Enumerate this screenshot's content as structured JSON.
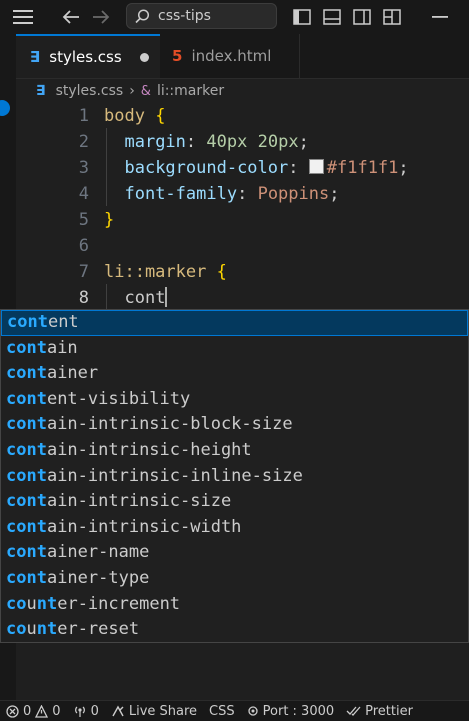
{
  "titlebar": {
    "search_text": "css-tips"
  },
  "tabs": [
    {
      "label": "styles.css",
      "icon": "css-file-icon",
      "active": true,
      "dirty": true
    },
    {
      "label": "index.html",
      "icon": "html-file-icon",
      "active": false
    }
  ],
  "breadcrumbs": {
    "file": "styles.css",
    "separator": "›",
    "symbol": "li::marker"
  },
  "editor": {
    "line_numbers": [
      "1",
      "2",
      "3",
      "4",
      "5",
      "6",
      "7",
      "8"
    ],
    "l1_selector": "body",
    "l1_brace": "{",
    "l2_prop": "margin",
    "l2_colon": ":",
    "l2_val1": "40px",
    "l2_val2": "20px",
    "l2_semi": ";",
    "l3_prop": "background-color",
    "l3_colon": ":",
    "l3_val": "#f1f1f1",
    "l3_semi": ";",
    "l4_prop": "font-family",
    "l4_colon": ":",
    "l4_val": "Poppins",
    "l4_semi": ";",
    "l5_brace": "}",
    "l7_selector": "li::marker",
    "l7_brace": "{",
    "l8_typed": "cont"
  },
  "suggestions": [
    {
      "match": "cont",
      "rest": "ent"
    },
    {
      "match": "cont",
      "rest": "ain"
    },
    {
      "match": "cont",
      "rest": "ainer"
    },
    {
      "match": "cont",
      "rest": "ent-visibility"
    },
    {
      "match": "cont",
      "rest": "ain-intrinsic-block-size"
    },
    {
      "match": "cont",
      "rest": "ain-intrinsic-height"
    },
    {
      "match": "cont",
      "rest": "ain-intrinsic-inline-size"
    },
    {
      "match": "cont",
      "rest": "ain-intrinsic-size"
    },
    {
      "match": "cont",
      "rest": "ain-intrinsic-width"
    },
    {
      "match": "cont",
      "rest": "ainer-name"
    },
    {
      "match": "cont",
      "rest": "ainer-type"
    },
    {
      "match": "co",
      "mid": "u",
      "match2": "nt",
      "rest": "er-increment"
    },
    {
      "match": "co",
      "mid": "u",
      "match2": "nt",
      "rest": "er-reset"
    }
  ],
  "status": {
    "errors": "0",
    "warnings": "0",
    "ports": "0",
    "live_share": "Live Share",
    "language": "CSS",
    "port": "Port : 3000",
    "prettier": "Prettier"
  },
  "colors": {
    "accent": "#0078d4",
    "match": "#2aaaff",
    "selected_bg": "#04395e"
  }
}
